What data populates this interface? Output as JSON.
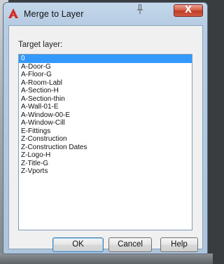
{
  "window": {
    "title": "Merge to Layer",
    "close_glyph": "X",
    "app_icon": "autocad-logo-icon",
    "accent": "#c03c28"
  },
  "dialog": {
    "target_label": "Target layer:",
    "selected_layer": "0",
    "layers": [
      "0",
      "A-Door-G",
      "A-Floor-G",
      "A-Room-Labl",
      "A-Section-H",
      "A-Section-thin",
      "A-Wall-01-E",
      "A-Window-00-E",
      "A-Window-Cill",
      "E-Fittings",
      "Z-Construction",
      "Z-Construction Dates",
      "Z-Logo-H",
      "Z-Title-G",
      "Z-Vports"
    ]
  },
  "buttons": {
    "ok": "OK",
    "cancel": "Cancel",
    "help": "Help"
  }
}
